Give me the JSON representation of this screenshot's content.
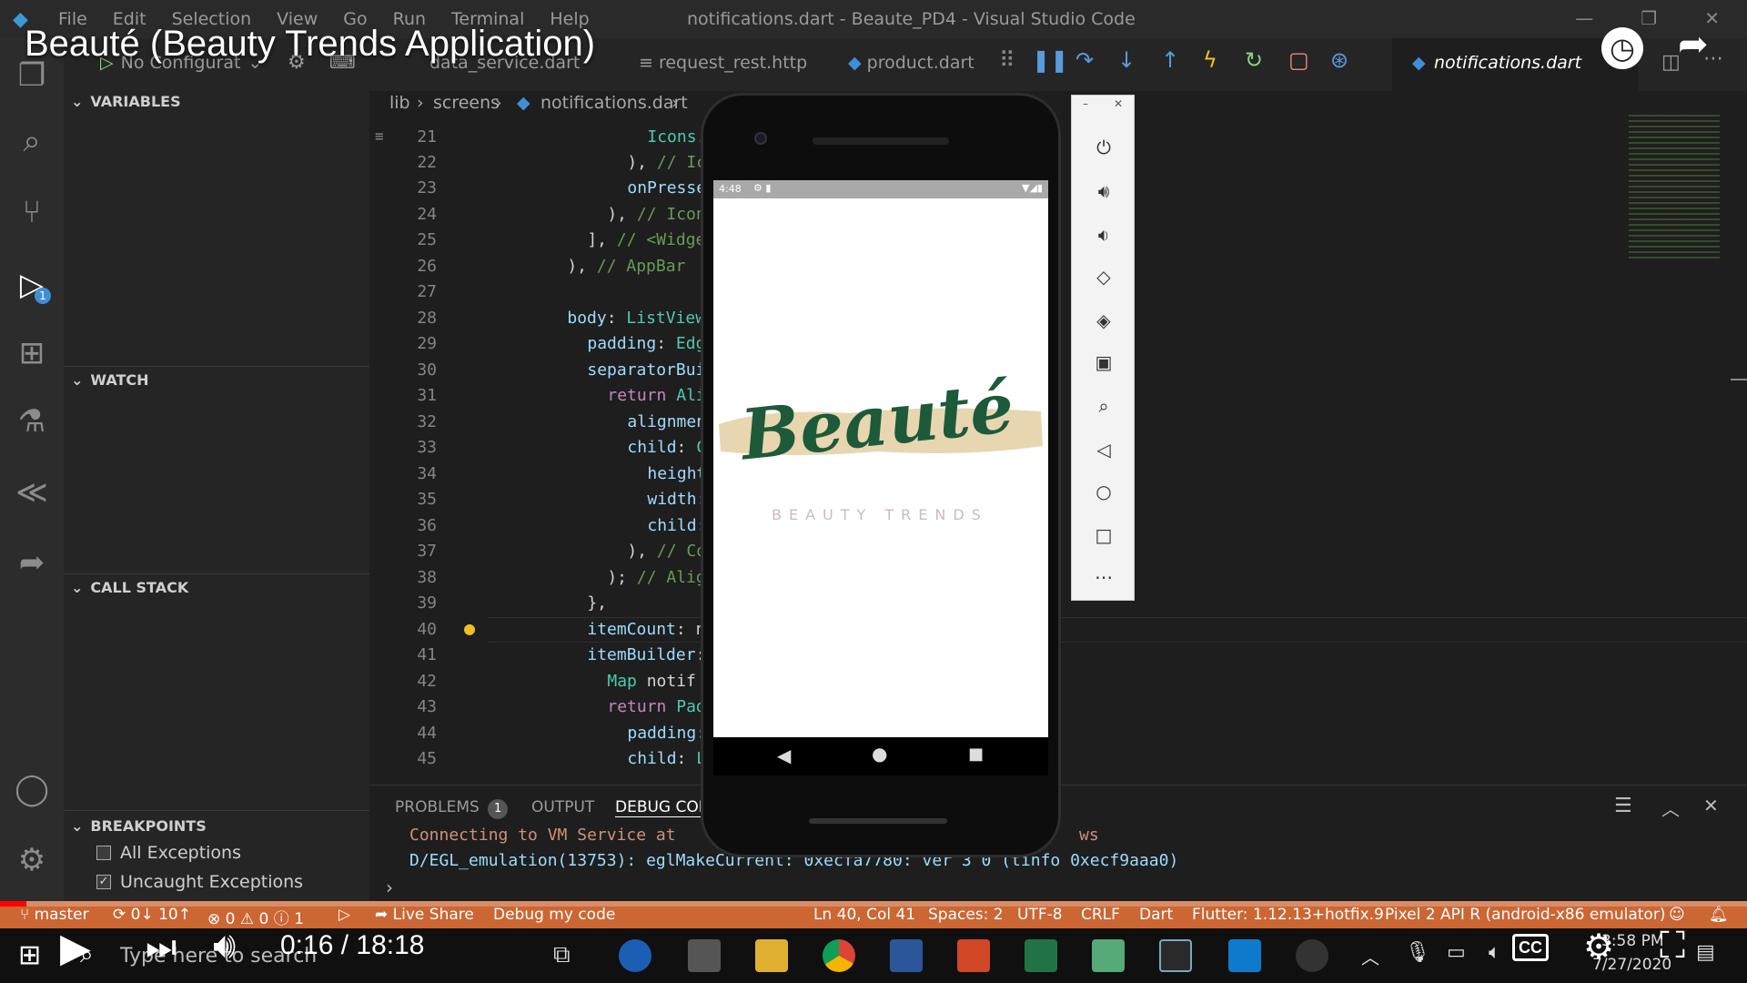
{
  "window": {
    "menu": [
      "File",
      "Edit",
      "Selection",
      "View",
      "Go",
      "Run",
      "Terminal",
      "Help"
    ],
    "title": "notifications.dart - Beaute_PD4 - Visual Studio Code"
  },
  "overlay": {
    "video_title": "Beauté (Beauty Trends Application)",
    "time": "0:16 / 18:18",
    "progress_fraction": 0.015,
    "cc": "CC"
  },
  "activity": {
    "debug_badge": "1"
  },
  "sidebar": {
    "run_config": "No Configurat",
    "variables": "VARIABLES",
    "watch": "WATCH",
    "call_stack": "CALL STACK",
    "breakpoints": "BREAKPOINTS",
    "bp_items": [
      {
        "label": "All Exceptions",
        "checked": false
      },
      {
        "label": "Uncaught Exceptions",
        "checked": true
      }
    ]
  },
  "tabs": {
    "t1": "data_service.dart",
    "t2": "request_rest.http",
    "t3": "product.dart",
    "active": "notifications.dart"
  },
  "breadcrumb": {
    "a": "lib",
    "b": "screens",
    "c": "notifications.dart"
  },
  "code": {
    "lines": [
      "21",
      "22",
      "23",
      "24",
      "25",
      "26",
      "27",
      "28",
      "29",
      "30",
      "31",
      "32",
      "33",
      "34",
      "35",
      "36",
      "37",
      "38",
      "39",
      "40",
      "41",
      "42",
      "43",
      "44",
      "45"
    ]
  },
  "panel": {
    "problems": "PROBLEMS",
    "problems_count": "1",
    "output": "OUTPUT",
    "debug": "DEBUG CON",
    "line1": "Connecting to VM Service at",
    "line1_tail": "ws",
    "line2": "D/EGL_emulation(13753): eglMakeCurrent: 0xecfa7780: ver 3 0 (tinfo 0xecf9aaa0)"
  },
  "status": {
    "branch": "master",
    "sync": "0↓ 10↑",
    "errors": "0",
    "warnings": "0",
    "infos": "1",
    "live_share": "Live Share",
    "debug_code": "Debug my code",
    "position": "Ln 40, Col 41",
    "spaces": "Spaces: 2",
    "encoding": "UTF-8",
    "eol": "CRLF",
    "language": "Dart",
    "flutter": "Flutter: 1.12.13+hotfix.9",
    "device": "Pixel 2 API R (android-x86 emulator)"
  },
  "taskbar": {
    "search": "Type here to search",
    "clock_time": "3:58 PM",
    "clock_date": "7/27/2020"
  },
  "phone": {
    "time": "4:48",
    "logo": "Beauté",
    "tagline": "BEAUTY TRENDS"
  },
  "colors": {
    "statusbar": "#cc6633",
    "logo_green": "#1d5a3a",
    "logo_brush": "#e8d6b0"
  }
}
